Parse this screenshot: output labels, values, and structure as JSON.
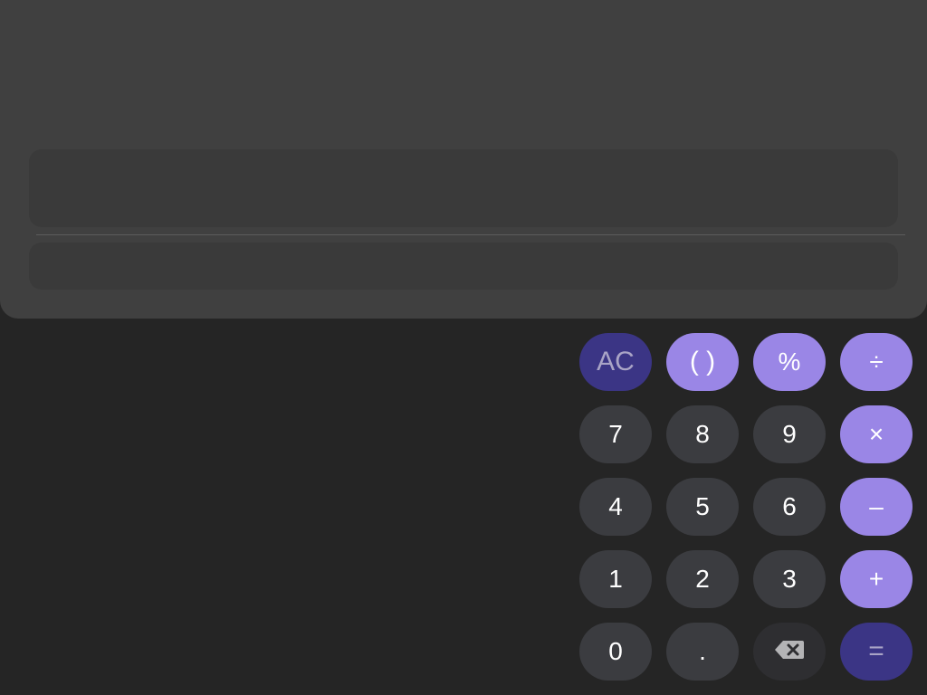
{
  "display": {
    "expression": "",
    "result": ""
  },
  "keypad": {
    "rows": [
      [
        {
          "label": "AC",
          "name": "all-clear-button",
          "style": "dark-accent"
        },
        {
          "label": "( )",
          "name": "parentheses-button",
          "style": "op"
        },
        {
          "label": "%",
          "name": "percent-button",
          "style": "op"
        },
        {
          "label": "÷",
          "name": "divide-button",
          "style": "op"
        }
      ],
      [
        {
          "label": "7",
          "name": "digit-7-button",
          "style": "num"
        },
        {
          "label": "8",
          "name": "digit-8-button",
          "style": "num"
        },
        {
          "label": "9",
          "name": "digit-9-button",
          "style": "num"
        },
        {
          "label": "×",
          "name": "multiply-button",
          "style": "op"
        }
      ],
      [
        {
          "label": "4",
          "name": "digit-4-button",
          "style": "num"
        },
        {
          "label": "5",
          "name": "digit-5-button",
          "style": "num"
        },
        {
          "label": "6",
          "name": "digit-6-button",
          "style": "num"
        },
        {
          "label": "–",
          "name": "subtract-button",
          "style": "op"
        }
      ],
      [
        {
          "label": "1",
          "name": "digit-1-button",
          "style": "num"
        },
        {
          "label": "2",
          "name": "digit-2-button",
          "style": "num"
        },
        {
          "label": "3",
          "name": "digit-3-button",
          "style": "num"
        },
        {
          "label": "+",
          "name": "add-button",
          "style": "op"
        }
      ],
      [
        {
          "label": "0",
          "name": "digit-0-button",
          "style": "num"
        },
        {
          "label": ".",
          "name": "decimal-button",
          "style": "num"
        },
        {
          "label": "",
          "name": "backspace-button",
          "style": "backspace",
          "icon": "backspace-icon"
        },
        {
          "label": "=",
          "name": "equals-button",
          "style": "dark-accent"
        }
      ]
    ]
  },
  "colors": {
    "background": "#252525",
    "display_panel": "#404040",
    "number_key": "#3b3c40",
    "operator_key": "#9a86e6",
    "accent_dark_key": "#3b3585"
  }
}
